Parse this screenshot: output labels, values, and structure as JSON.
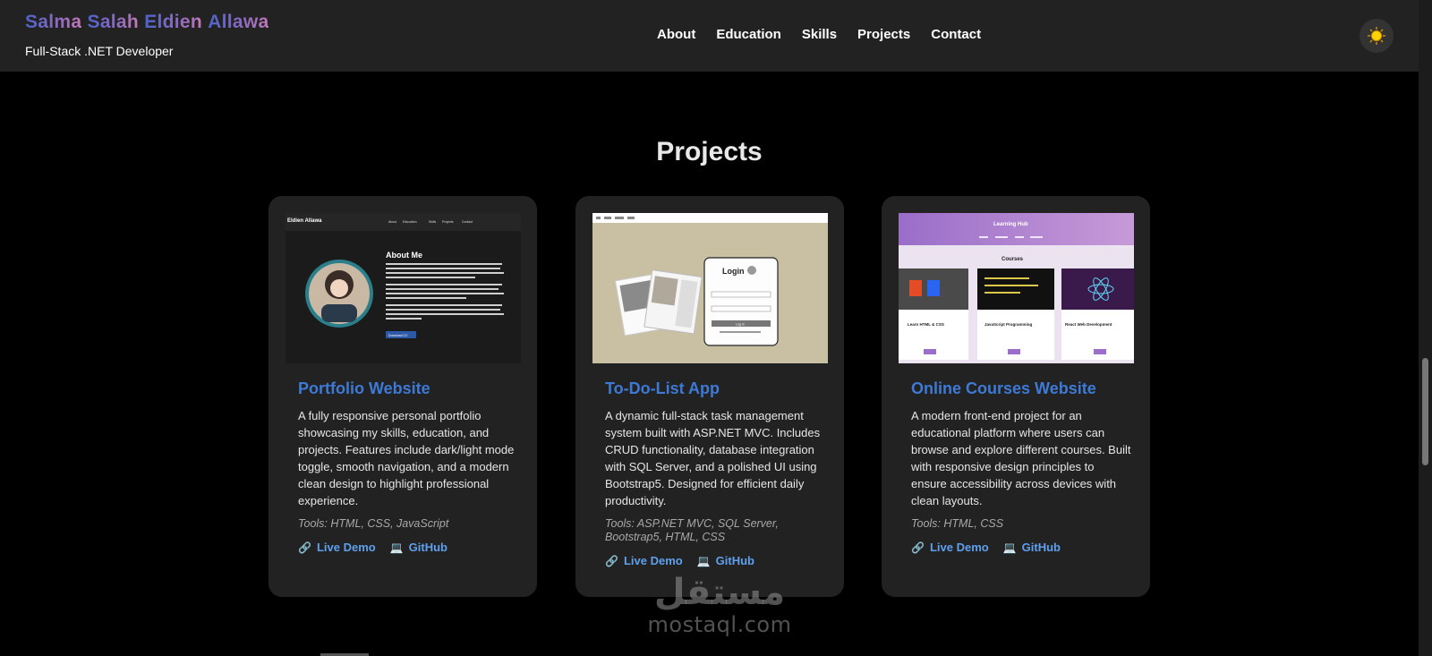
{
  "header": {
    "name_words": [
      "Salma",
      "Salah",
      "Eldien",
      "Allawa"
    ],
    "role": "Full-Stack .NET Developer",
    "nav": [
      "About",
      "Education",
      "Skills",
      "Projects",
      "Contact"
    ],
    "theme_toggle_icon": "sun-icon"
  },
  "section": {
    "title": "Projects"
  },
  "projects": [
    {
      "title": "Portfolio Website",
      "description": "A fully responsive personal portfolio showcasing my skills, education, and projects. Features include dark/light mode toggle, smooth navigation, and a modern clean design to highlight professional experience.",
      "tools": "Tools: HTML, CSS, JavaScript",
      "live_label": "Live Demo",
      "github_label": "GitHub",
      "thumb": {
        "brand": "Eldien Allawa",
        "nav": [
          "About",
          "Education",
          "Skills",
          "Projects",
          "Contact"
        ],
        "heading": "About Me",
        "button": "Download CV"
      }
    },
    {
      "title": "To-Do-List App",
      "description": "A dynamic full-stack task management system built with ASP.NET MVC. Includes CRUD functionality, database integration with SQL Server, and a polished UI using Bootstrap5. Designed for efficient daily productivity.",
      "tools": "Tools: ASP.NET MVC, SQL Server, Bootstrap5, HTML, CSS",
      "live_label": "Live Demo",
      "github_label": "GitHub",
      "thumb": {
        "heading": "Login",
        "button": "Log In"
      }
    },
    {
      "title": "Online Courses Website",
      "description": "A modern front-end project for an educational platform where users can browse and explore different courses. Built with responsive design principles to ensure accessibility across devices with clean layouts.",
      "tools": "Tools: HTML, CSS",
      "live_label": "Live Demo",
      "github_label": "GitHub",
      "thumb": {
        "brand": "Learning Hub",
        "heading": "Courses",
        "courses": [
          "Learn HTML & CSS",
          "JavaScript Programming",
          "React Web Development"
        ],
        "button": "Enroll"
      }
    }
  ],
  "watermark": {
    "arabic": "مستقل",
    "latin": "mostaql.com"
  },
  "colors": {
    "background": "#000000",
    "navbar": "#222222",
    "card": "#222222",
    "title_blue": "#3d7ad6",
    "link_blue": "#5ea0ee",
    "sun": "#ffd400"
  }
}
